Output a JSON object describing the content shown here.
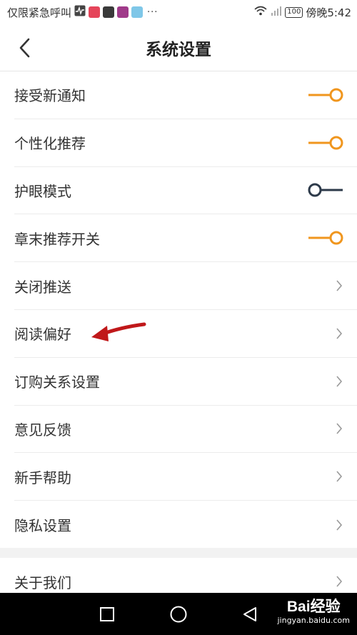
{
  "status_bar": {
    "left_text": "仅限紧急呼叫",
    "dots": "···",
    "battery": "100",
    "time": "傍晚5:42"
  },
  "header": {
    "title": "系统设置",
    "back_icon": "chevron-left-icon"
  },
  "settings": [
    {
      "label": "接受新通知",
      "control": "toggle",
      "on": true
    },
    {
      "label": "个性化推荐",
      "control": "toggle",
      "on": true
    },
    {
      "label": "护眼模式",
      "control": "toggle",
      "on": false
    },
    {
      "label": "章末推荐开关",
      "control": "toggle",
      "on": true
    },
    {
      "label": "关闭推送",
      "control": "chevron"
    },
    {
      "label": "阅读偏好",
      "control": "chevron"
    },
    {
      "label": "订购关系设置",
      "control": "chevron"
    },
    {
      "label": "意见反馈",
      "control": "chevron"
    },
    {
      "label": "新手帮助",
      "control": "chevron"
    },
    {
      "label": "隐私设置",
      "control": "chevron"
    }
  ],
  "about": {
    "label": "关于我们",
    "control": "chevron"
  },
  "colors": {
    "toggle_on": "#f0961e",
    "toggle_off": "#2d3a4a",
    "annotation_arrow": "#c0181a"
  },
  "watermark": {
    "brand": "Bai经验",
    "url": "jingyan.baidu.com"
  }
}
